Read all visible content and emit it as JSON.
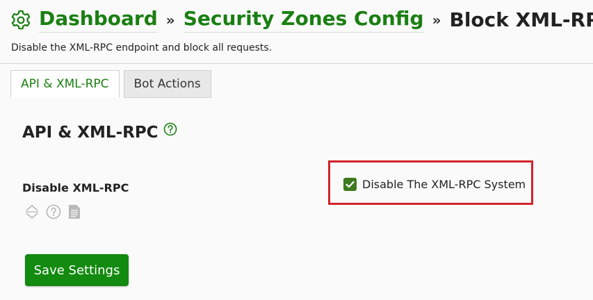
{
  "header": {
    "breadcrumbs": [
      {
        "label": "Dashboard"
      },
      {
        "label": "Security Zones Config"
      }
    ],
    "separator": "»",
    "current": "Block XML-RPC",
    "subtitle": "Disable the XML-RPC endpoint and block all requests.",
    "icon": "gear-icon"
  },
  "tabs": [
    {
      "label": "API & XML-RPC",
      "active": true
    },
    {
      "label": "Bot Actions",
      "active": false
    }
  ],
  "section": {
    "title": "API & XML-RPC",
    "help_icon": "help-circle-icon"
  },
  "field": {
    "label": "Disable XML-RPC",
    "icons": [
      "sort-arrows-icon",
      "help-circle-icon",
      "document-icon"
    ],
    "option_label": "Disable The XML-RPC System",
    "option_checked": true
  },
  "actions": {
    "save_label": "Save Settings"
  },
  "colors": {
    "accent": "#1a7f12",
    "button": "#138a10",
    "checkbox": "#3d7a1f",
    "highlight_border": "#d2232a"
  }
}
